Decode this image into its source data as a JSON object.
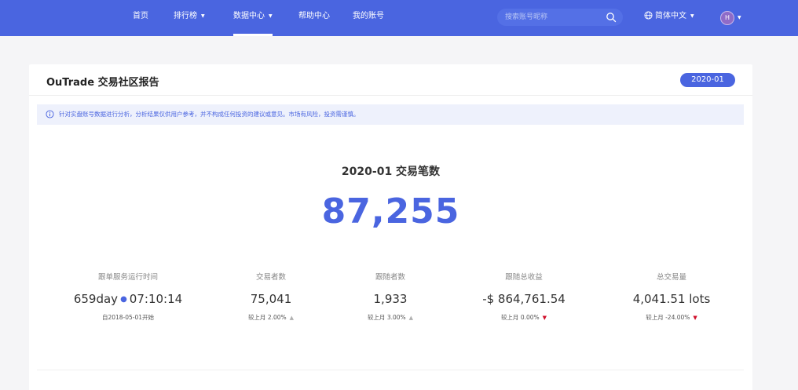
{
  "nav": {
    "items": [
      {
        "label": "首页",
        "has_caret": false
      },
      {
        "label": "排行榜",
        "has_caret": true
      },
      {
        "label": "数据中心",
        "has_caret": true,
        "active": true
      },
      {
        "label": "帮助中心",
        "has_caret": false
      },
      {
        "label": "我的账号",
        "has_caret": false
      }
    ],
    "caret": "▼",
    "search_placeholder": "搜索账号昵称",
    "language": "简体中文",
    "avatar_initial": "H"
  },
  "report": {
    "title": "OuTrade 交易社区报告",
    "period": "2020-01",
    "notice": "针对实盘账号数据进行分析，分析结果仅供用户参考，并不构成任何投资的建议或意见。市场有风险，投资需谨慎。",
    "metric_label": "2020-01 交易笔数",
    "metric_value": "87,255",
    "stats": [
      {
        "label": "跟单服务运行时间",
        "value_a": "659day",
        "value_b": "07:10:14",
        "sub": "自2018-05-01开始"
      },
      {
        "label": "交易者数",
        "value": "75,041",
        "sub": "较上月 2.00%",
        "trend": "up"
      },
      {
        "label": "跟随者数",
        "value": "1,933",
        "sub": "较上月 3.00%",
        "trend": "up"
      },
      {
        "label": "跟随总收益",
        "value": "-$ 864,761.54",
        "sub": "较上月 0.00%",
        "trend": "down"
      },
      {
        "label": "总交易量",
        "value": "4,041.51 lots",
        "sub": "较上月 -24.00%",
        "trend": "down"
      }
    ]
  },
  "colors": {
    "brand": "#4a65e0",
    "trend_down": "#d0102b",
    "trend_up": "#b0b0b0"
  }
}
